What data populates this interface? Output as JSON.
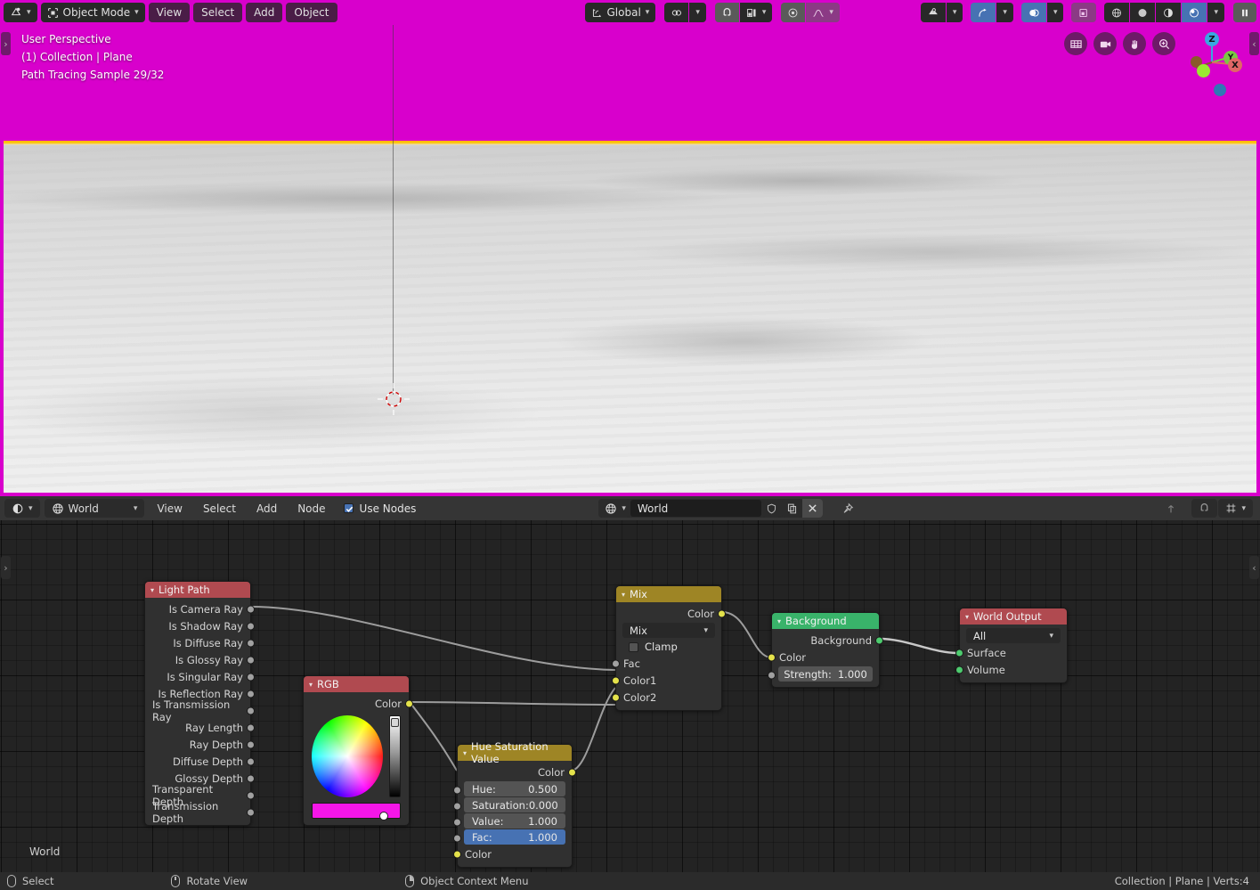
{
  "viewport": {
    "header": {
      "editor_type_icon": "editor-type-icon",
      "mode": "Object Mode",
      "menus": [
        "View",
        "Select",
        "Add",
        "Object"
      ],
      "transform_orientation": "Global",
      "snap_icon": "magnet-icon",
      "proportional_icon": "proportional-editing-icon",
      "overlay_icon": "overlays-icon",
      "xray_icon": "xray-icon",
      "visibility_icon": "visibility-icon",
      "gizmo_icon": "gizmo-icon",
      "shading_modes": [
        "wireframe",
        "solid",
        "material-preview",
        "rendered"
      ],
      "shading_active": "rendered",
      "pause_icon": "pause-render-icon"
    },
    "overlay_text": [
      "User Perspective",
      "(1) Collection | Plane",
      "Path Tracing Sample 29/32"
    ],
    "nav_buttons": [
      "grid-view-icon",
      "camera-view-icon",
      "pan-view-icon",
      "zoom-view-icon"
    ],
    "gizmo_axes": [
      "Z",
      "Y",
      "X"
    ],
    "sky_color": "#d800cc",
    "horizon_color": "#ffb400"
  },
  "node_editor": {
    "header": {
      "editor_type_icon": "shader-editor-icon",
      "shader_type": "World",
      "menus": [
        "View",
        "Select",
        "Add",
        "Node"
      ],
      "use_nodes_label": "Use Nodes",
      "use_nodes_checked": true,
      "datablock_icon": "world-icon",
      "datablock_name": "World",
      "shield_icon": "fake-user-icon",
      "copy_icon": "new-datablock-icon",
      "close_icon": "unlink-datablock-icon",
      "pin_icon": "pin-icon",
      "snap_base_icon": "snap-base-icon",
      "magnet_icon": "magnet-icon",
      "snap_target_icon": "snap-target-icon"
    },
    "breadcrumb": "World",
    "nodes": {
      "light_path": {
        "title": "Light Path",
        "header_color": "#b04a50",
        "outputs": [
          "Is Camera Ray",
          "Is Shadow Ray",
          "Is Diffuse Ray",
          "Is Glossy Ray",
          "Is Singular Ray",
          "Is Reflection Ray",
          "Is Transmission Ray",
          "Ray Length",
          "Ray Depth",
          "Diffuse Depth",
          "Glossy Depth",
          "Transparent Depth",
          "Transmission Depth"
        ]
      },
      "rgb": {
        "title": "RGB",
        "header_color": "#b04a50",
        "output_label": "Color",
        "swatch_color": "#f516e8"
      },
      "hsv": {
        "title": "Hue Saturation Value",
        "header_color": "#9e8525",
        "output_label": "Color",
        "fields": [
          {
            "label": "Hue:",
            "value": "0.500",
            "selected": false
          },
          {
            "label": "Saturation:",
            "value": "0.000",
            "selected": false
          },
          {
            "label": "Value:",
            "value": "1.000",
            "selected": false
          },
          {
            "label": "Fac:",
            "value": "1.000",
            "selected": true
          }
        ],
        "input_label": "Color"
      },
      "mix": {
        "title": "Mix",
        "header_color": "#9e8525",
        "output_label": "Color",
        "blend_mode": "Mix",
        "clamp_label": "Clamp",
        "clamp_checked": false,
        "inputs": [
          "Fac",
          "Color1",
          "Color2"
        ]
      },
      "background": {
        "title": "Background",
        "header_color": "#39b36a",
        "output_label": "Background",
        "input_label": "Color",
        "strength_label": "Strength:",
        "strength_value": "1.000"
      },
      "world_output": {
        "title": "World Output",
        "header_color": "#b04a50",
        "target": "All",
        "inputs": [
          "Surface",
          "Volume"
        ]
      }
    }
  },
  "status_bar": {
    "items": [
      {
        "icon": "mouse-left-icon",
        "label": "Select"
      },
      {
        "icon": "mouse-middle-icon",
        "label": "Rotate View"
      },
      {
        "icon": "mouse-right-icon",
        "label": "Object Context Menu"
      }
    ],
    "scene_stats": "Collection | Plane | Verts:4"
  }
}
